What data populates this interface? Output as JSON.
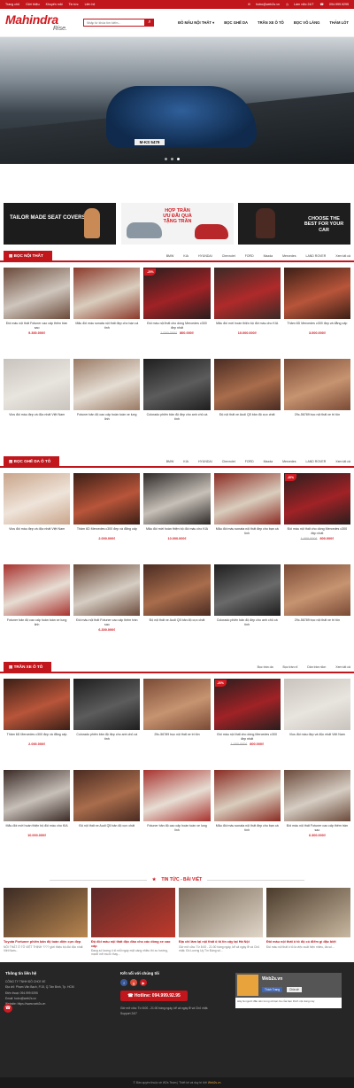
{
  "topbar": {
    "links": [
      "Trang chủ",
      "Giới thiệu",
      "Khuyến mãi",
      "Tin tức",
      "Liên hệ"
    ],
    "email": "hotro@web2s.vn",
    "hours": "Làm việc 24/7",
    "phone": "094.999.9295"
  },
  "header": {
    "logo_main": "Mahindra",
    "logo_sub": "Rise.",
    "search_placeholder": "Nhập từ khóa tìm kiếm...",
    "nav": [
      "ĐỒ MẪU NỘI THẤT ▾",
      "BỌC GHẾ DA",
      "TRẦN XE Ô TÔ",
      "BỌC VÔ LĂNG",
      "THẢM LÓT"
    ]
  },
  "hero": {
    "plate": "M-KS 5479"
  },
  "banners": [
    {
      "text": "TAILOR MADE SEAT COVERS"
    },
    {
      "text": "HỢP TRẦN ƯU ĐÃI QUÀ TẶNG TRẦN"
    },
    {
      "text": "CHOOSE THE BEST FOR YOUR CAR"
    }
  ],
  "sections": [
    {
      "title": "BỌC NỘI THẤT",
      "tabs": [
        "BMW",
        "KIA",
        "HYUNDAI",
        "Chevrolet",
        "FORD",
        "Mazda",
        "Mercedes",
        "LAND ROVER",
        "Xem tất cả"
      ],
      "products": [
        {
          "name": "Đồi màu nội thất Fotuner cao cấp thêm trần sao",
          "old": "",
          "price": "9.300.000₫",
          "tag": "",
          "colors": [
            "#6b4a3a",
            "#cfc6bd"
          ]
        },
        {
          "name": "Mẫu đồi màu sonata nội thất đẹp cho bạn cá tính",
          "old": "",
          "price": "",
          "tag": "",
          "colors": [
            "#8a3a2b",
            "#d9cdbd"
          ]
        },
        {
          "name": "Đồi màu nội thất cho dòng Mercedes c300 đẹp nhất",
          "old": "1.000.000₫",
          "price": "800.000₫",
          "tag": "-20%",
          "colors": [
            "#2a1e1e",
            "#a02226"
          ]
        },
        {
          "name": "Mẫu đồi mới hoàn thiện bộ đồi màu cho KIA",
          "old": "",
          "price": "10.000.000₫",
          "tag": "",
          "colors": [
            "#3a2a26",
            "#b02a2a"
          ]
        },
        {
          "name": "Thảm 6D Mercedes c300 đẹp và đẳng cấp",
          "old": "",
          "price": "3.000.000₫",
          "tag": "",
          "colors": [
            "#3b1f16",
            "#b8553a"
          ]
        },
        {
          "name": "Vios đồi màu đẹp và độc nhất Việt Nam",
          "old": "",
          "price": "",
          "tag": "",
          "colors": [
            "#c9c3bd",
            "#e8e4de"
          ]
        },
        {
          "name": "Fotuner bản độ cao cấp hoàn toàn xe lung linh",
          "old": "",
          "price": "",
          "tag": "",
          "colors": [
            "#9a7a64",
            "#e5ddd3"
          ]
        },
        {
          "name": "Colorado phiên bản độ đẹp cho anh chủ cá tính",
          "old": "",
          "price": "",
          "tag": "",
          "colors": [
            "#1e1e1e",
            "#5c5c5c"
          ]
        },
        {
          "name": "Độ nội thất xe Audi Q5 bản độ cực chất",
          "old": "",
          "price": "",
          "tag": "",
          "colors": [
            "#4a2b22",
            "#a96d4c"
          ]
        },
        {
          "name": "29c-56789 bọc nội thất xe tri tôn",
          "old": "",
          "price": "",
          "tag": "",
          "colors": [
            "#7a4a35",
            "#c79471"
          ]
        }
      ]
    },
    {
      "title": "BỌC GHẾ DA Ô TÔ",
      "tabs": [
        "BMW",
        "KIA",
        "HYUNDAI",
        "Chevrolet",
        "FORD",
        "Mazda",
        "Mercedes",
        "LAND ROVER",
        "Xem tất cả"
      ],
      "products": [
        {
          "name": "Vios đồi màu đẹp và độc nhất Việt Nam",
          "old": "",
          "price": "",
          "tag": "",
          "colors": [
            "#c9a58a",
            "#efe4da"
          ]
        },
        {
          "name": "Thảm 6D Mercedes c300 đẹp và đẳng cấp",
          "old": "",
          "price": "2.000.000₫",
          "tag": "",
          "colors": [
            "#3b1f16",
            "#b8553a"
          ]
        },
        {
          "name": "Mẫu đồi mới hoàn thiện bộ đồi màu cho KIA",
          "old": "",
          "price": "10.000.000₫",
          "tag": "",
          "colors": [
            "#2e2a28",
            "#c7c0b8"
          ]
        },
        {
          "name": "Mẫu đồi màu sonata nội thất đẹp cho bạn cá tính",
          "old": "",
          "price": "",
          "tag": "",
          "colors": [
            "#8a2b22",
            "#d9cdbd"
          ]
        },
        {
          "name": "Đồi màu nội thất cho dòng Mercedes c300 đẹp nhất",
          "old": "1.000.000₫",
          "price": "800.000₫",
          "tag": "-20%",
          "colors": [
            "#2a1e1e",
            "#a02226"
          ]
        },
        {
          "name": "Fotuner bản độ cao cấp hoàn toàn xe lung linh",
          "old": "",
          "price": "",
          "tag": "",
          "colors": [
            "#a8322e",
            "#e7ddd3"
          ]
        },
        {
          "name": "Đồi màu nội thất Fotuner cao cấp thêm trần sao",
          "old": "",
          "price": "6.300.000₫",
          "tag": "",
          "colors": [
            "#6b4a3a",
            "#d6cdc3"
          ]
        },
        {
          "name": "Độ nội thất xe Audi Q5 bản độ cực chất",
          "old": "",
          "price": "",
          "tag": "",
          "colors": [
            "#4a2b22",
            "#a96d4c"
          ]
        },
        {
          "name": "Colorado phiên bản độ đẹp cho anh chủ cá tính",
          "old": "",
          "price": "",
          "tag": "",
          "colors": [
            "#1e1e1e",
            "#6a6a6a"
          ]
        },
        {
          "name": "29c-56789 bọc nội thất xe tri tôn",
          "old": "",
          "price": "",
          "tag": "",
          "colors": [
            "#7a4a35",
            "#c79471"
          ]
        }
      ]
    },
    {
      "title": "TRẦN XE Ô TÔ",
      "tabs": [
        "Bọc trần da",
        "Bọc trần nỉ",
        "Dán trần nỉon",
        "Xem tất cả"
      ],
      "products": [
        {
          "name": "Thảm 6D Mercedes c300 đẹp và đẳng cấp",
          "old": "",
          "price": "2.000.000₫",
          "tag": "",
          "colors": [
            "#3b1f16",
            "#b8553a"
          ]
        },
        {
          "name": "Colorado phiên bản độ đẹp cho anh chủ cá tính",
          "old": "",
          "price": "",
          "tag": "",
          "colors": [
            "#1e1e1e",
            "#5c5c5c"
          ]
        },
        {
          "name": "29c-56789 bọc nội thất xe tri tôn",
          "old": "",
          "price": "",
          "tag": "",
          "colors": [
            "#7a4a35",
            "#c79471"
          ]
        },
        {
          "name": "Đồi màu nội thất cho dòng Mercedes c300 đẹp nhất",
          "old": "1.000.000₫",
          "price": "800.000₫",
          "tag": "-20%",
          "colors": [
            "#2a1e1e",
            "#a02226"
          ]
        },
        {
          "name": "Vios đồi màu đẹp và độc nhất Việt Nam",
          "old": "",
          "price": "",
          "tag": "",
          "colors": [
            "#c9c3bd",
            "#e8e4de"
          ]
        },
        {
          "name": "Mẫu đồi mới hoàn thiện bộ đồi màu cho KIA",
          "old": "",
          "price": "10.000.000₫",
          "tag": "",
          "colors": [
            "#3a2a26",
            "#c7c0b8"
          ]
        },
        {
          "name": "Độ nội thất xe Audi Q5 bản độ cực chất",
          "old": "",
          "price": "",
          "tag": "",
          "colors": [
            "#4a2b22",
            "#a96d4c"
          ]
        },
        {
          "name": "Fotuner bản độ cao cấp hoàn toàn xe lung linh",
          "old": "",
          "price": "",
          "tag": "",
          "colors": [
            "#a8322e",
            "#e7ddd3"
          ]
        },
        {
          "name": "Mẫu đồi màu sonata nội thất đẹp cho bạn cá tính",
          "old": "",
          "price": "",
          "tag": "",
          "colors": [
            "#8a2b22",
            "#d9cdbd"
          ]
        },
        {
          "name": "Đồi màu nội thất Fotuner cao cấp thêm trần sao",
          "old": "",
          "price": "6.300.000₫",
          "tag": "",
          "colors": [
            "#6b4a3a",
            "#d6cdc3"
          ]
        }
      ]
    }
  ],
  "news": {
    "heading": "TIN TỨC - BÀI VIẾT",
    "items": [
      {
        "title": "Toyota Fortuner phiên bản độ toàn diện cực đẹp",
        "desc": "NỘI THẤT Ô TÔ VIỆT THỊNH ???? giới thiệu bộ đồi độc nhất Việt Nam...",
        "colors": [
          "#3a2a24",
          "#b8864f"
        ]
      },
      {
        "title": "Độ đồi màu nội thất độc đáo cho các dòng xe cao cấp",
        "desc": "Đang số lượng ô tô mỗi ngày một càng nhiều thì xu hướng, mạnh mẽ muốn thay...",
        "colors": [
          "#5a2a2a",
          "#c0392b"
        ]
      },
      {
        "title": "Địa chỉ làm lại nội thất ô tô tin cậy tại Hà Nội",
        "desc": "Giờ mở cửa: Từ 8:00 - 21:00 hàng ngày, kể cả ngày lễ và Chủ nhật. Đồ Lương Uy Tín Đáng số...",
        "colors": [
          "#7a6a5a",
          "#e0d6c8"
        ]
      },
      {
        "title": "Đồi màu nội thất ô tô độ có điểm gì đặc biệt",
        "desc": "Đồi màu nội thất ô tô là việc xuất hiện nhiều, đa số...",
        "colors": [
          "#4a3a2a",
          "#c9b8a0"
        ]
      }
    ]
  },
  "footer": {
    "contact_title": "Thông tin liên hệ",
    "contact_lines": [
      "CÔNG TY TNHH ĐỒ CHƠI XE",
      "Địa chỉ: Phạm Văn Bạch, P.15, Q.Tân Bình, Tp. HCM",
      "Điện thoại: 094.999.9295",
      "Email: hotro@web2s.vn",
      "Website: https://www.web2s.vn"
    ],
    "social_title": "Kết nối với chúng tôi",
    "hotline": "Hotline: 094.999.92.95",
    "social_lines": [
      "Giờ mở cửa: Từ 8:00 - 21:00 hàng ngày, kể cả ngày lễ và Chủ nhật.",
      "Support 24/7"
    ],
    "fb_name": "Web2s.vn",
    "fb_like": "Thích Trang",
    "fb_share": "Chia sẻ",
    "fb_msg": "Hãy là người đầu tiên trong số bạn bè của bạn thích nội dung này",
    "copyright": "© Bản quyền thuộc về W2s Team | Thiết kế và duy trì bởi",
    "copyright_brand": "Web2s.vn"
  },
  "colors": {
    "accent": "#c0161c"
  }
}
